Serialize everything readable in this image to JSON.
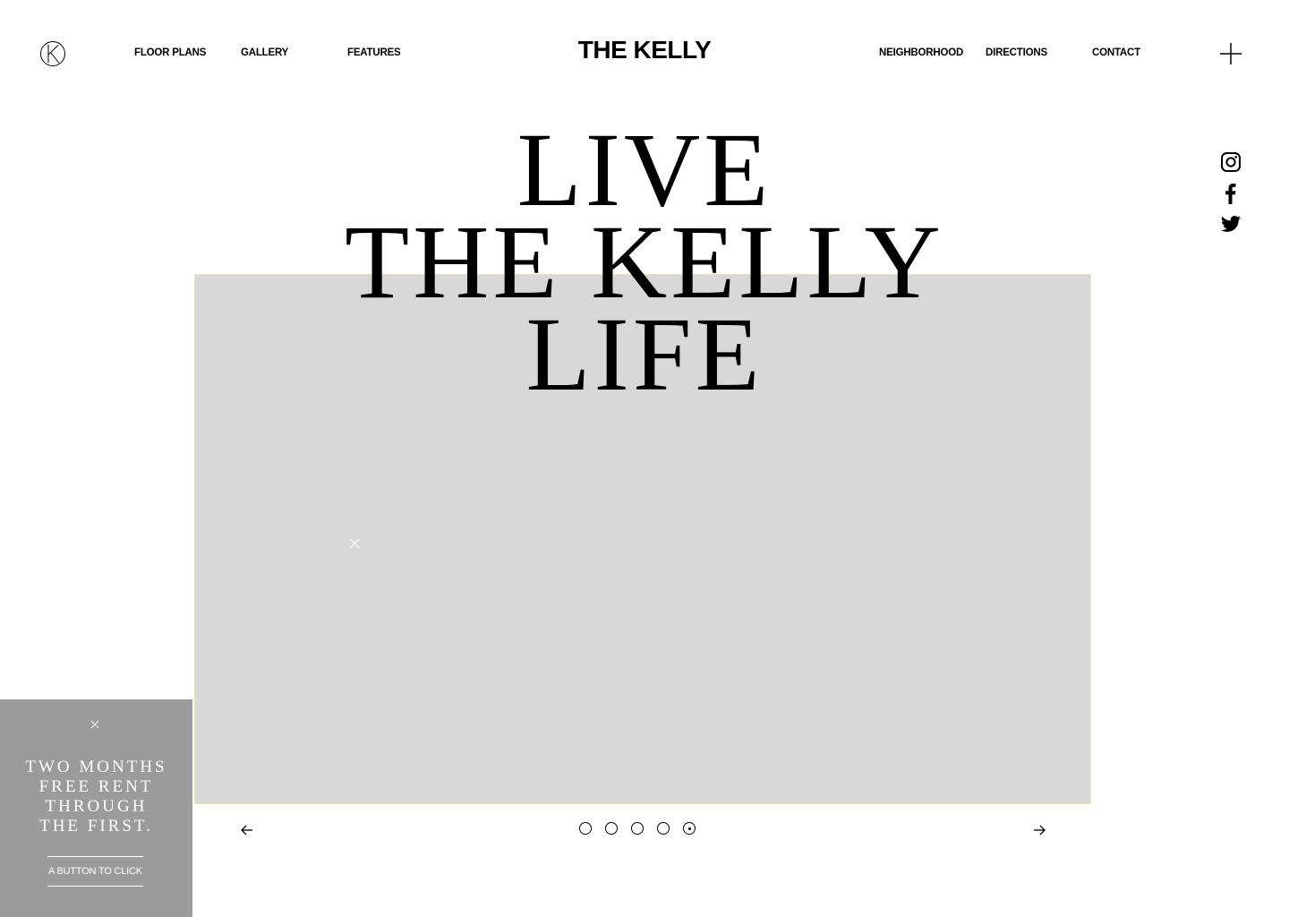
{
  "header": {
    "brand": "THE KELLY",
    "nav_left": [
      "FLOOR PLANS",
      "GALLERY",
      "FEATURES"
    ],
    "nav_right": [
      "NEIGHBORHOOD",
      "DIRECTIONS",
      "CONTACT"
    ]
  },
  "hero": {
    "headline_lines": [
      "LIVE",
      "THE KELLY",
      "LIFE"
    ]
  },
  "social": [
    "instagram-icon",
    "facebook-icon",
    "twitter-icon"
  ],
  "carousel": {
    "slide_count": 5,
    "active_index": 4
  },
  "promo": {
    "lines": [
      "TWO MONTHS",
      "FREE RENT",
      "THROUGH",
      "THE FIRST."
    ],
    "button_label": "A BUTTON TO CLICK"
  },
  "colors": {
    "promo_bg": "#9b9b9b",
    "media_placeholder": "#d8d8d8",
    "media_border": "#efe4a8"
  }
}
